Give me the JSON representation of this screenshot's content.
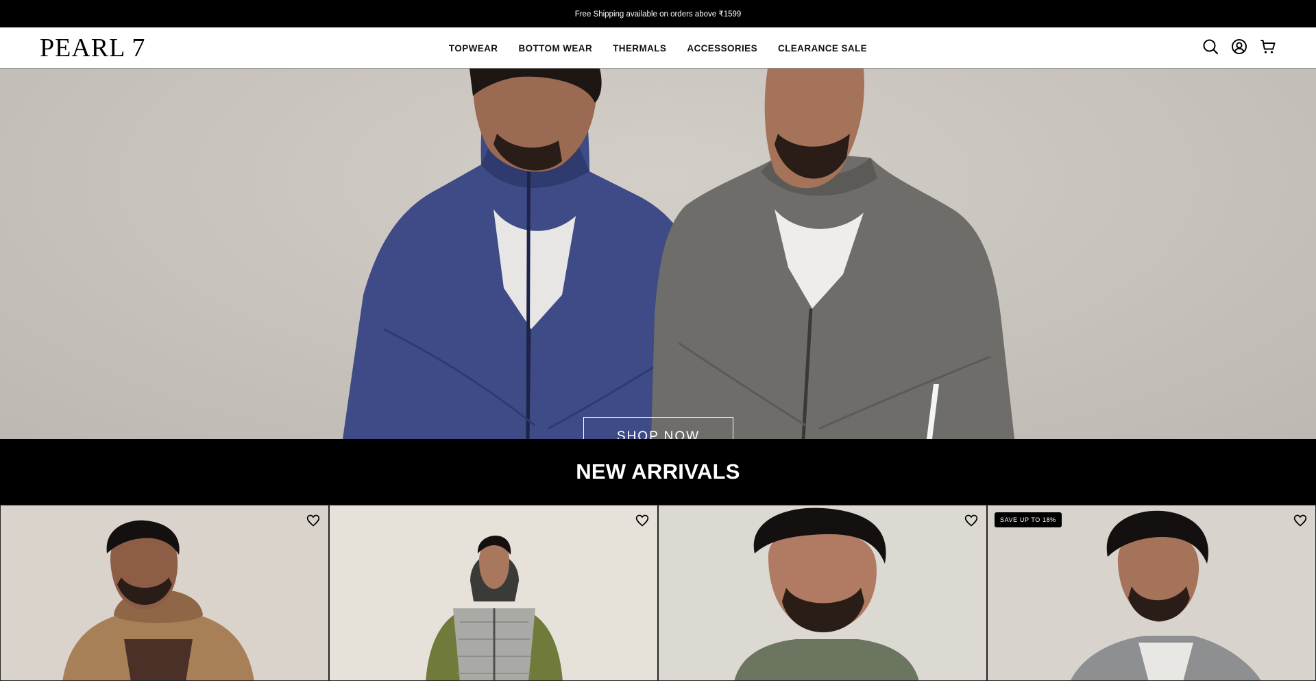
{
  "announcement": {
    "text": "Free Shipping available on orders above ₹1599"
  },
  "header": {
    "logo": "PEARL 7",
    "nav": [
      {
        "label": "TOPWEAR"
      },
      {
        "label": "BOTTOM WEAR"
      },
      {
        "label": "THERMALS"
      },
      {
        "label": "ACCESSORIES"
      },
      {
        "label": "CLEARANCE SALE"
      }
    ],
    "icons": [
      "search-icon",
      "account-icon",
      "cart-icon"
    ]
  },
  "hero": {
    "button_label": "SHOP NOW"
  },
  "section": {
    "title": "NEW ARRIVALS"
  },
  "products": [
    {
      "badge": "",
      "colors": {
        "bg": "#d9d3cc",
        "jacket": "#a97f58",
        "inner": "#4a3026"
      }
    },
    {
      "badge": "",
      "colors": {
        "bg": "#e6e2da",
        "jacket": "#a9aaa6",
        "inner": "#6f7a3b"
      }
    },
    {
      "badge": "",
      "colors": {
        "bg": "#dcd8d2",
        "jacket": "#6b7560",
        "inner": "#555d4a"
      }
    },
    {
      "badge": "SAVE UP TO 18%",
      "colors": {
        "bg": "#d8d3cd",
        "jacket": "#8d8f91",
        "inner": "#e9e7e3"
      }
    }
  ],
  "colors": {
    "navy_jacket": "#3e4b86",
    "grey_jacket": "#6e6d6a",
    "skin": "#9a6a52"
  }
}
